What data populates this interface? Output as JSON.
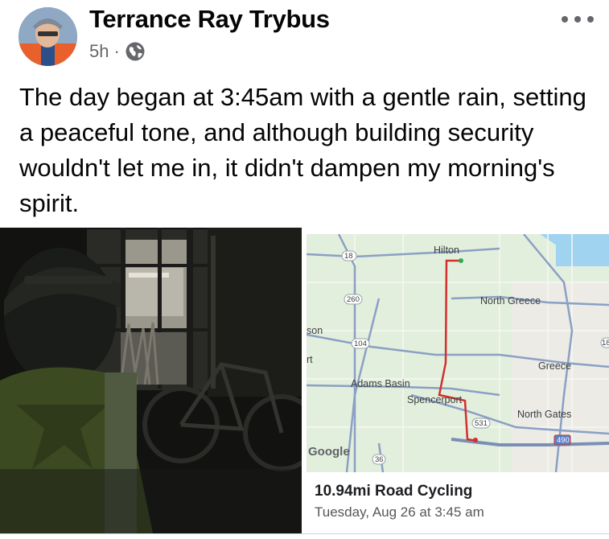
{
  "post": {
    "author": "Terrance Ray Trybus",
    "time": "5h",
    "separator": "·",
    "privacy_icon": "globe-icon",
    "more_icon": "more-options-icon",
    "text": "The day began at 3:45am with a gentle rain, setting a peaceful tone, and although building security wouldn't let me in, it didn't dampen my morning's spirit."
  },
  "map": {
    "labels": {
      "hilton": "Hilton",
      "north_greece": "North Greece",
      "son": "son",
      "rt": "rt",
      "greece": "Greece",
      "adams_basin": "Adams Basin",
      "spencerport": "Spencerport",
      "north_gates": "North Gates",
      "google": "Google"
    },
    "shields": {
      "r18": "18",
      "r260": "260",
      "r104": "104",
      "r18b": "18",
      "r531": "531",
      "r490": "490",
      "r36": "36"
    }
  },
  "activity": {
    "title": "10.94mi Road Cycling",
    "date": "Tuesday, Aug 26 at 3:45 am"
  },
  "colors": {
    "route": "#d32f2f",
    "map_bg": "#e3efdd",
    "road": "#8aa0c4",
    "water": "#9fd3f0"
  }
}
